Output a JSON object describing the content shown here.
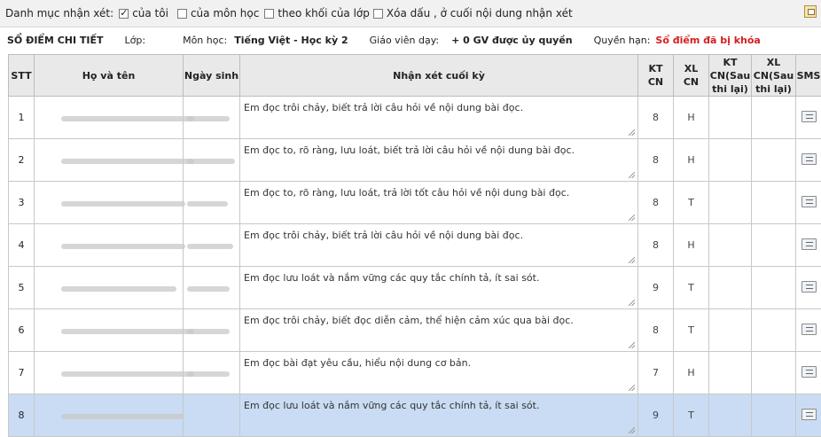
{
  "filter": {
    "label": "Danh mục nhận xét:",
    "options": [
      {
        "label": "của tôi",
        "checked": true
      },
      {
        "label": "của môn học",
        "checked": false
      },
      {
        "label": "theo khối của lớp",
        "checked": false
      },
      {
        "label": "Xóa dấu , ở cuối nội dung nhận xét",
        "checked": false
      }
    ],
    "export_icon": "excel-export-icon"
  },
  "info": {
    "title": "SỔ ĐIỂM CHI TIẾT",
    "class_label": "Lớp:",
    "class_value": "",
    "subject_label": "Môn học:",
    "subject_value": "Tiếng Việt - Học kỳ 2",
    "teacher_label": "Giáo viên dạy:",
    "teacher_value": "+ 0 GV được ủy quyền",
    "permission_label": "Quyền hạn:",
    "permission_value": "Sổ điểm đã bị khóa",
    "permission_color": "#d51e1e"
  },
  "table": {
    "headers": {
      "stt": "STT",
      "name": "Họ và tên",
      "dob": "Ngày sinh",
      "comment": "Nhận xét cuối kỳ",
      "kt_cn_1": "KT",
      "kt_cn_2": "CN",
      "xl_cn_1": "XL",
      "xl_cn_2": "CN",
      "kt_re_1": "KT",
      "kt_re_2": "CN(Sau",
      "kt_re_3": "thi lại)",
      "xl_re_1": "XL",
      "xl_re_2": "CN(Sau",
      "xl_re_3": "thi lại)",
      "sms": "SMS"
    },
    "rows": [
      {
        "stt": "1",
        "comment": "Em đọc trôi chảy, biết trả lời câu hỏi về nội dung bài đọc.",
        "kt": "8",
        "xl": "H",
        "kt_re": "",
        "xl_re": "",
        "selected": false
      },
      {
        "stt": "2",
        "comment": "Em đọc to, rõ ràng, lưu loát, biết trả lời câu hỏi về nội dung bài đọc.",
        "kt": "8",
        "xl": "H",
        "kt_re": "",
        "xl_re": "",
        "selected": false
      },
      {
        "stt": "3",
        "comment": "Em đọc to, rõ ràng, lưu loát, trả lời tốt câu hỏi về nội dung bài đọc.",
        "kt": "8",
        "xl": "T",
        "kt_re": "",
        "xl_re": "",
        "selected": false
      },
      {
        "stt": "4",
        "comment": "Em đọc trôi chảy, biết trả lời câu hỏi về nội dung bài đọc.",
        "kt": "8",
        "xl": "H",
        "kt_re": "",
        "xl_re": "",
        "selected": false
      },
      {
        "stt": "5",
        "comment": "Em đọc lưu loát và nắm vững các quy tắc chính tả, ít sai sót.",
        "kt": "9",
        "xl": "T",
        "kt_re": "",
        "xl_re": "",
        "selected": false
      },
      {
        "stt": "6",
        "comment": "Em đọc trôi chảy, biết đọc diễn cảm, thể hiện cảm xúc qua bài đọc.",
        "kt": "8",
        "xl": "T",
        "kt_re": "",
        "xl_re": "",
        "selected": false
      },
      {
        "stt": "7",
        "comment": "Em đọc bài đạt yêu cầu, hiểu nội dung cơ bản.",
        "kt": "7",
        "xl": "H",
        "kt_re": "",
        "xl_re": "",
        "selected": false
      },
      {
        "stt": "8",
        "comment": "Em đọc lưu loát và nắm vững các quy tắc chính tả, ít sai sót.",
        "kt": "9",
        "xl": "T",
        "kt_re": "",
        "xl_re": "",
        "selected": true
      }
    ]
  }
}
